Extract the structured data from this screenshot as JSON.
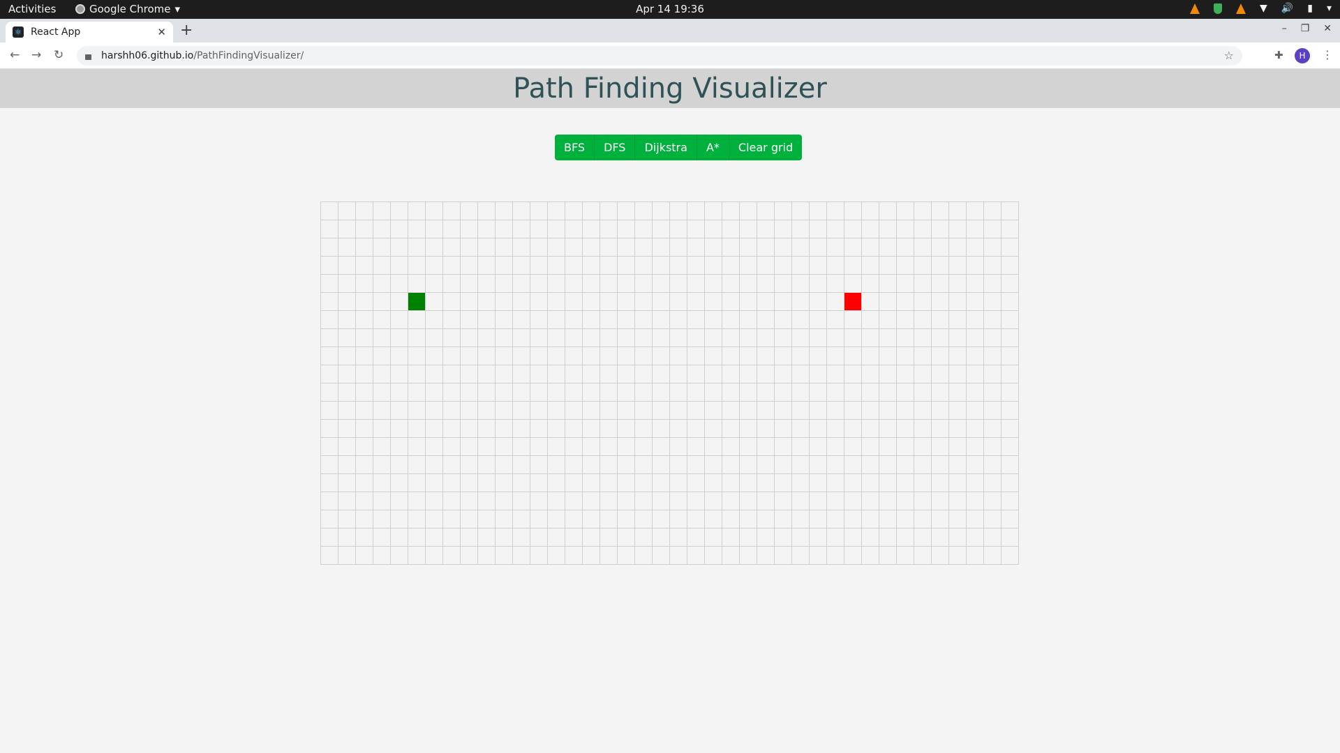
{
  "system_bar": {
    "activities_label": "Activities",
    "app_name": "Google Chrome",
    "app_menu_arrow": "▾",
    "date_time": "Apr 14  19:36",
    "tray_icons": [
      "vlc-icon",
      "shield-icon",
      "vlc-icon",
      "wifi-icon",
      "volume-icon",
      "battery-icon",
      "system-menu-icon"
    ]
  },
  "browser": {
    "tab_title": "React App",
    "tab_favicon": "react-icon",
    "tab_close_glyph": "✕",
    "new_tab_glyph": "+",
    "window_controls": {
      "minimize": "–",
      "restore": "❐",
      "close": "✕"
    },
    "url_host": "harshh06.github.io",
    "url_path": "/PathFindingVisualizer/",
    "back_glyph": "←",
    "forward_glyph": "→",
    "reload_glyph": "↻",
    "bookmark_glyph": "☆",
    "extensions_glyph": "✚",
    "profile_initial": "H",
    "menu_glyph": "⋮"
  },
  "app": {
    "title": "Path Finding Visualizer",
    "buttons": [
      {
        "label": "BFS"
      },
      {
        "label": "DFS"
      },
      {
        "label": "Dijkstra"
      },
      {
        "label": "A*"
      },
      {
        "label": "Clear grid"
      }
    ],
    "grid": {
      "rows": 20,
      "cols": 40,
      "start_node": {
        "row": 5,
        "col": 5
      },
      "end_node": {
        "row": 5,
        "col": 30
      }
    },
    "colors": {
      "button": "#00b03c",
      "start": "#008000",
      "end": "#ff0000",
      "title": "#2f5256",
      "header_bg": "#d3d3d3"
    }
  }
}
